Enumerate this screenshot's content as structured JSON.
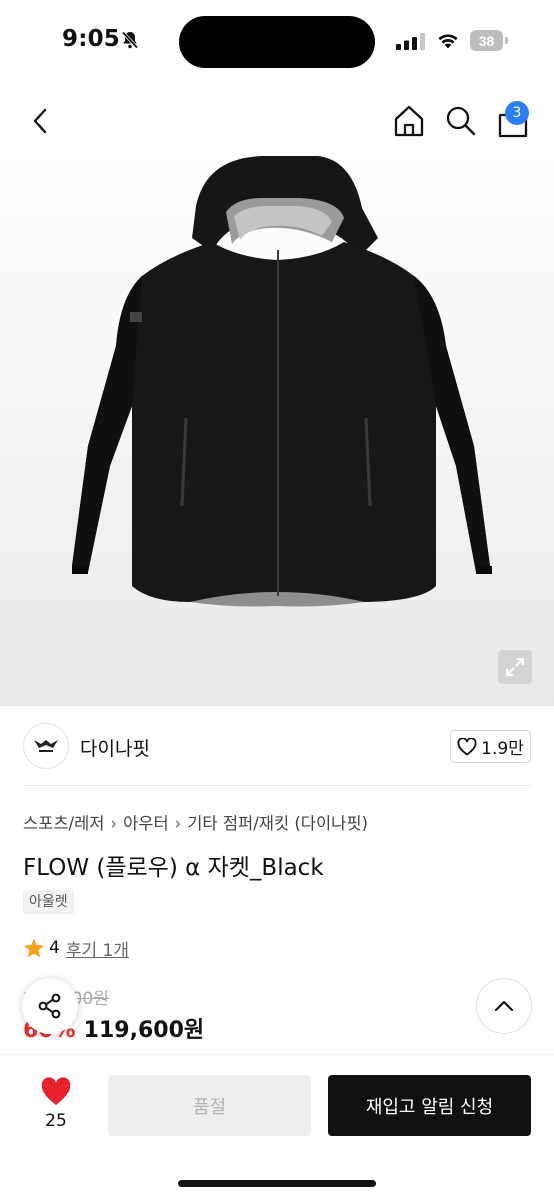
{
  "status_bar": {
    "time": "9:05",
    "battery": "38"
  },
  "nav": {
    "cart_count": "3"
  },
  "brand": {
    "name": "다이나핏",
    "likes": "1.9만"
  },
  "breadcrumb": [
    "스포츠/레저",
    "아우터",
    "기타 점퍼/재킷 (다이나핏)"
  ],
  "product": {
    "title": "FLOW (플로우) α 자켓_Black",
    "tag": "아울렛",
    "rating": "4",
    "review_link": "후기 1개",
    "original_price": "299,000원",
    "discount": "60%",
    "sale_price": "119,600원"
  },
  "bottom_bar": {
    "wish_count": "25",
    "soldout_label": "품절",
    "restock_label": "재입고 알림 신청"
  },
  "colors": {
    "accent_blue": "#2b7ff5",
    "discount_red": "#ef2c2c",
    "heart_red": "#e8222c",
    "star_orange": "#f7a21b"
  },
  "icons": [
    "back-icon",
    "home-icon",
    "search-icon",
    "cart-icon",
    "expand-icon",
    "heart-outline-icon",
    "star-icon",
    "share-icon",
    "chevron-up-icon",
    "heart-filled-icon"
  ]
}
